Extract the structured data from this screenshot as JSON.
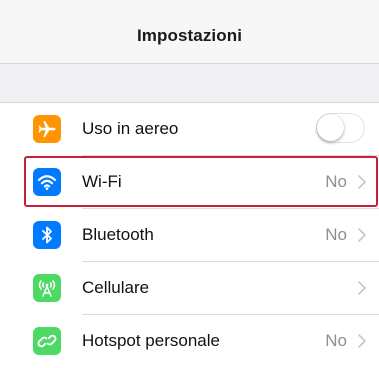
{
  "header": {
    "title": "Impostazioni"
  },
  "settings": {
    "items": [
      {
        "label": "Uso in aereo",
        "icon": "airplane-icon",
        "icon_color": "#ff9500",
        "control": "toggle",
        "toggle_on": false
      },
      {
        "label": "Wi-Fi",
        "icon": "wifi-icon",
        "icon_color": "#007aff",
        "value": "No",
        "highlighted": true
      },
      {
        "label": "Bluetooth",
        "icon": "bluetooth-icon",
        "icon_color": "#007aff",
        "value": "No"
      },
      {
        "label": "Cellulare",
        "icon": "cellular-antenna-icon",
        "icon_color": "#4cd964",
        "value": ""
      },
      {
        "label": "Hotspot personale",
        "icon": "hotspot-link-icon",
        "icon_color": "#4cd964",
        "value": "No"
      }
    ]
  },
  "colors": {
    "highlight_border": "#c6203a",
    "chevron": "#c7c7cc"
  }
}
